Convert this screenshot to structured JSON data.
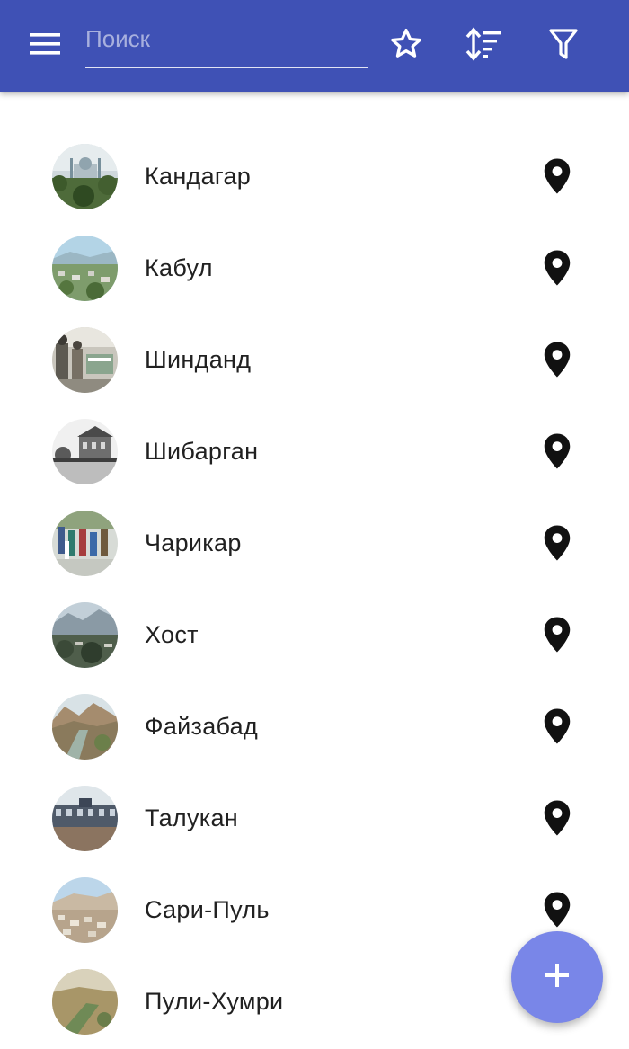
{
  "toolbar": {
    "search": {
      "placeholder": "Поиск",
      "value": ""
    },
    "background_color": "#3f51b5"
  },
  "cities": [
    {
      "name": "Кандагар"
    },
    {
      "name": "Кабул"
    },
    {
      "name": "Шинданд"
    },
    {
      "name": "Шибарган"
    },
    {
      "name": "Чарикар"
    },
    {
      "name": "Хост"
    },
    {
      "name": "Файзабад"
    },
    {
      "name": "Талукан"
    },
    {
      "name": "Сари-Пуль"
    },
    {
      "name": "Пули-Хумри"
    }
  ],
  "icons": {
    "menu": "hamburger-menu-icon",
    "favorite": "star-outline-icon",
    "sort": "sort-icon",
    "filter": "filter-icon",
    "location": "map-pin-icon",
    "add": "plus-icon"
  },
  "fab": {
    "color": "#7986e8"
  }
}
